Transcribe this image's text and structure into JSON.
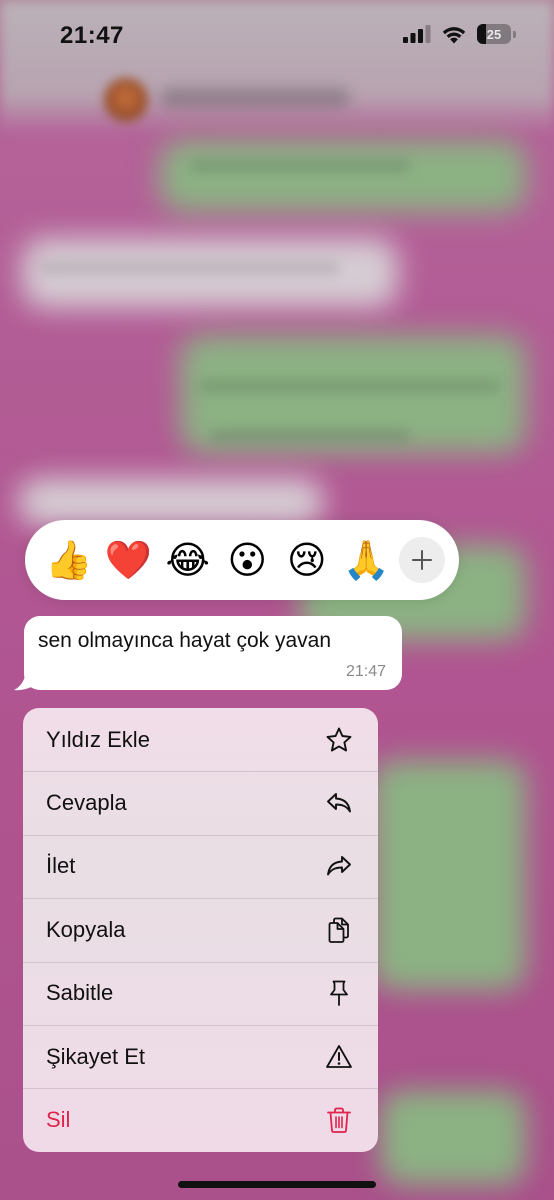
{
  "status_bar": {
    "time": "21:47",
    "battery": "25",
    "battery_level_percent": 25,
    "icons": [
      "signal-icon",
      "wifi-icon",
      "battery-icon"
    ]
  },
  "reactions": {
    "emojis": [
      "👍",
      "❤️",
      "😂",
      "😮",
      "😢",
      "🙏"
    ],
    "more_icon": "plus-icon"
  },
  "message": {
    "text": "sen olmayınca hayat çok yavan",
    "time": "21:47"
  },
  "menu": {
    "items": [
      {
        "label": "Yıldız Ekle",
        "icon": "star-icon"
      },
      {
        "label": "Cevapla",
        "icon": "reply-icon"
      },
      {
        "label": "İlet",
        "icon": "forward-icon"
      },
      {
        "label": "Kopyala",
        "icon": "copy-icon"
      },
      {
        "label": "Sabitle",
        "icon": "pin-icon"
      },
      {
        "label": "Şikayet Et",
        "icon": "warning-icon"
      },
      {
        "label": "Sil",
        "icon": "trash-icon"
      }
    ]
  },
  "colors": {
    "danger": "#e0244b",
    "bubble": "#ffffff",
    "background": "#b85e98",
    "menu": "#ecdde6"
  }
}
